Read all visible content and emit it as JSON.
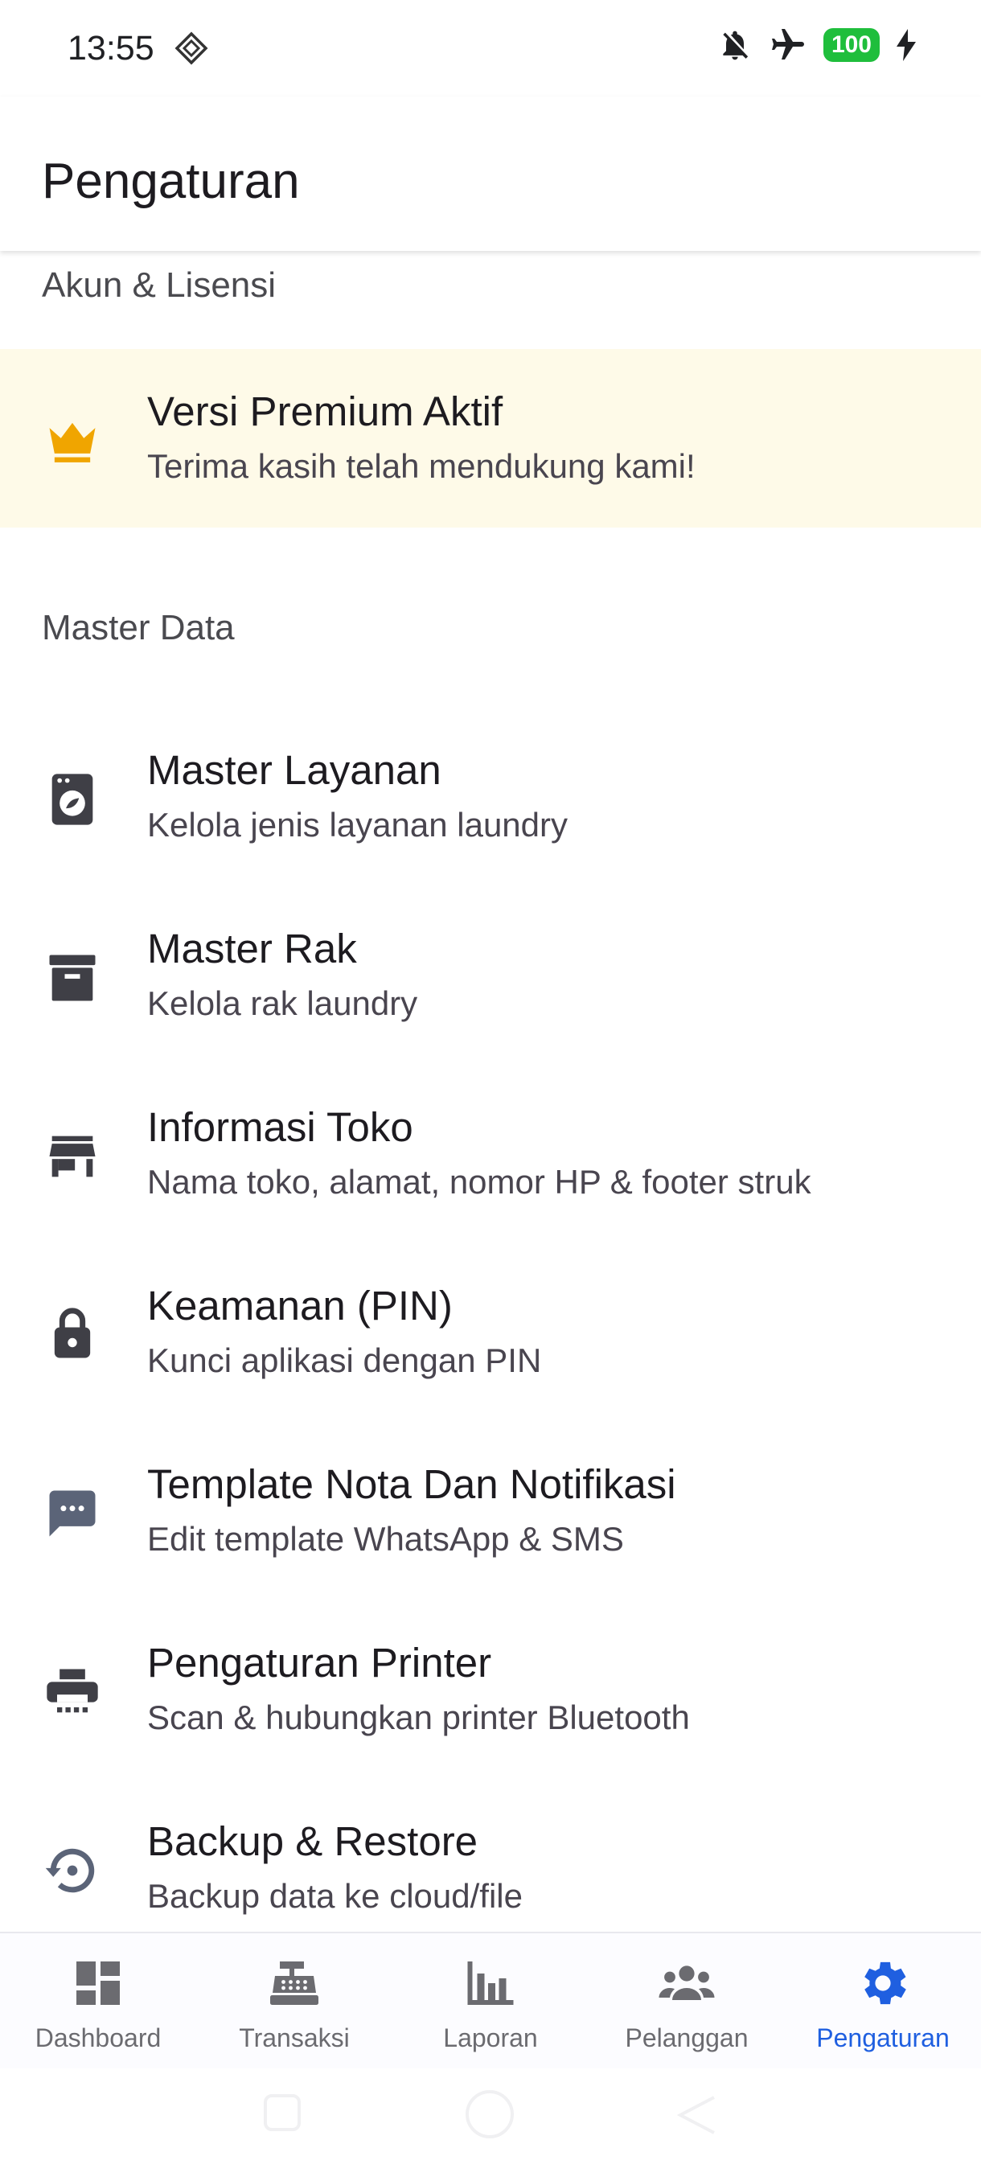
{
  "status_bar": {
    "time": "13:55",
    "battery": "100",
    "icons": [
      "diamond-icon",
      "bell-off-icon",
      "airplane-icon",
      "battery-icon",
      "charging-bolt-icon"
    ]
  },
  "app_bar": {
    "title": "Pengaturan"
  },
  "sections": {
    "account": {
      "header": "Akun & Lisensi",
      "premium": {
        "title": "Versi Premium Aktif",
        "subtitle": "Terima kasih telah mendukung kami!",
        "icon": "crown-icon",
        "color": "#f0a500",
        "background": "#fefae8"
      }
    },
    "master": {
      "header": "Master Data",
      "items": [
        {
          "title": "Master Layanan",
          "subtitle": "Kelola jenis layanan laundry",
          "icon": "washing-machine-icon"
        },
        {
          "title": "Master Rak",
          "subtitle": "Kelola rak laundry",
          "icon": "archive-icon"
        },
        {
          "title": "Informasi Toko",
          "subtitle": "Nama toko, alamat, nomor HP & footer struk",
          "icon": "store-icon"
        },
        {
          "title": "Keamanan (PIN)",
          "subtitle": "Kunci aplikasi dengan PIN",
          "icon": "lock-icon"
        },
        {
          "title": "Template Nota Dan Notifikasi",
          "subtitle": "Edit template WhatsApp & SMS",
          "icon": "chat-icon"
        },
        {
          "title": "Pengaturan Printer",
          "subtitle": "Scan & hubungkan printer Bluetooth",
          "icon": "printer-icon"
        },
        {
          "title": "Backup & Restore",
          "subtitle": "Backup data ke cloud/file",
          "icon": "restore-icon"
        }
      ]
    }
  },
  "bottom_nav": {
    "items": [
      {
        "label": "Dashboard",
        "icon": "dashboard-icon"
      },
      {
        "label": "Transaksi",
        "icon": "cash-register-icon"
      },
      {
        "label": "Laporan",
        "icon": "bar-chart-icon"
      },
      {
        "label": "Pelanggan",
        "icon": "people-icon"
      },
      {
        "label": "Pengaturan",
        "icon": "gear-icon"
      }
    ],
    "active": "Pengaturan",
    "active_color": "#1f5fe0",
    "inactive_color": "#6b6b70"
  }
}
